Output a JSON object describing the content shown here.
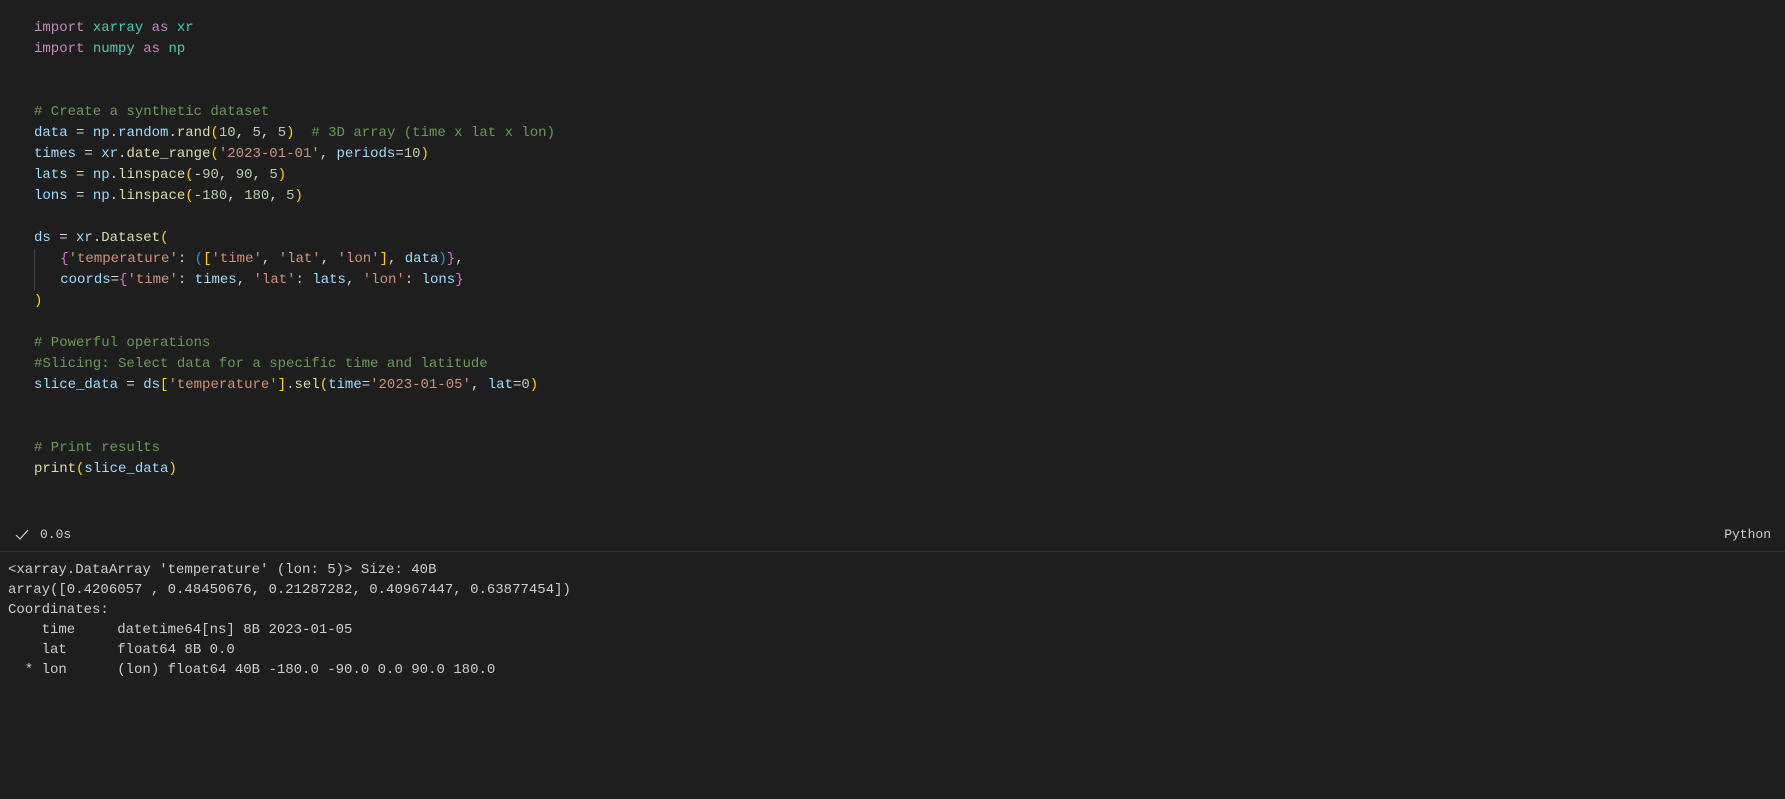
{
  "code": {
    "l1_import": "import",
    "l1_mod": "xarray",
    "l1_as": "as",
    "l1_alias": "xr",
    "l2_import": "import",
    "l2_mod": "numpy",
    "l2_as": "as",
    "l2_alias": "np",
    "l4_comment": "# Create a synthetic dataset",
    "l5_var": "data",
    "l5_eq": " = ",
    "l5_np": "np",
    "l5_dot1": ".",
    "l5_random": "random",
    "l5_dot2": ".",
    "l5_rand": "rand",
    "l5_args": "(10, 5, 5)",
    "l5_n1": "10",
    "l5_n2": "5",
    "l5_n3": "5",
    "l5_comment": "  # 3D array (time x lat x lon)",
    "l6_var": "times",
    "l6_xr": "xr",
    "l6_daterange": "date_range",
    "l6_str": "'2023-01-01'",
    "l6_periods": "periods",
    "l6_pn": "10",
    "l7_var": "lats",
    "l7_np": "np",
    "l7_linspace": "linspace",
    "l7_a": "-90",
    "l7_b": "90",
    "l7_c": "5",
    "l8_var": "lons",
    "l8_a": "-180",
    "l8_b": "180",
    "l8_c": "5",
    "l10_ds": "ds",
    "l10_xr": "xr",
    "l10_Dataset": "Dataset",
    "l11_tempkey": "'temperature'",
    "l11_time": "'time'",
    "l11_lat": "'lat'",
    "l11_lon": "'lon'",
    "l11_data": "data",
    "l12_coords": "coords",
    "l12_timek": "'time'",
    "l12_times": "times",
    "l12_latk": "'lat'",
    "l12_lats": "lats",
    "l12_lonk": "'lon'",
    "l12_lons": "lons",
    "l15_comment": "# Powerful operations",
    "l16_comment": "#Slicing: Select data for a specific time and latitude",
    "l17_var": "slice_data",
    "l17_ds": "ds",
    "l17_key": "'temperature'",
    "l17_sel": "sel",
    "l17_time": "time",
    "l17_timeval": "'2023-01-05'",
    "l17_lat": "lat",
    "l17_latval": "0",
    "l20_comment": "# Print results",
    "l21_print": "print",
    "l21_arg": "slice_data"
  },
  "status": {
    "duration": "0.0s",
    "kernel": "Python"
  },
  "output": {
    "l1": "<xarray.DataArray 'temperature' (lon: 5)> Size: 40B",
    "l2": "array([0.4206057 , 0.48450676, 0.21287282, 0.40967447, 0.63877454])",
    "l3": "Coordinates:",
    "l4": "    time     datetime64[ns] 8B 2023-01-05",
    "l5": "    lat      float64 8B 0.0",
    "l6": "  * lon      (lon) float64 40B -180.0 -90.0 0.0 90.0 180.0"
  }
}
